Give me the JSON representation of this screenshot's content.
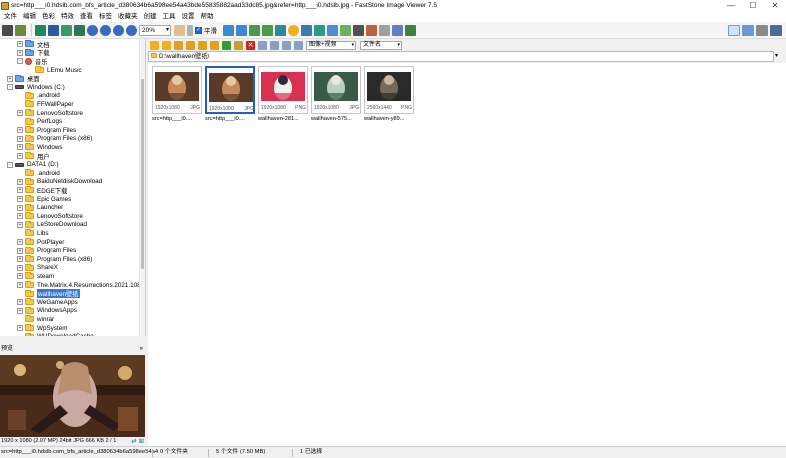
{
  "window": {
    "title": "src=http___i0.hdslb.com_bfs_article_d380634b6a598ee54a43bde55835882aad33dc85.jpg&refer=http___i0.hdslb.jpg - FastStone Image Viewer 7.5",
    "minimize": "—",
    "maximize": "☐",
    "close": "✕"
  },
  "menu": [
    "文件",
    "编辑",
    "色彩",
    "特效",
    "查看",
    "标签",
    "收藏夹",
    "创建",
    "工具",
    "设置",
    "帮助"
  ],
  "toolbar": {
    "zoom": "20%",
    "fit_label": "平滑",
    "fit_checked": "✓"
  },
  "browser_toolbar": {
    "view_mode": "图像+视频",
    "sort_by": "文件名"
  },
  "path": "D:\\wallhaven壁纸\\",
  "tree": [
    {
      "label": "文档",
      "level": 1,
      "exp": "+",
      "icon": "blue"
    },
    {
      "label": "下载",
      "level": 1,
      "exp": "+",
      "icon": "blue"
    },
    {
      "label": "音乐",
      "level": 1,
      "exp": "-",
      "icon": "red"
    },
    {
      "label": "LEmu Music",
      "level": 2,
      "exp": "",
      "icon": "yellow"
    },
    {
      "label": "桌面",
      "level": 0,
      "exp": "+",
      "icon": "blue"
    },
    {
      "label": "Windows (C:)",
      "level": 0,
      "exp": "-",
      "icon": "drive"
    },
    {
      "label": ".android",
      "level": 1,
      "exp": "",
      "icon": "yellow"
    },
    {
      "label": "FFWallPaper",
      "level": 1,
      "exp": "",
      "icon": "yellow"
    },
    {
      "label": "LenovoSoftstore",
      "level": 1,
      "exp": "+",
      "icon": "yellow"
    },
    {
      "label": "PerfLogs",
      "level": 1,
      "exp": "",
      "icon": "yellow"
    },
    {
      "label": "Program Files",
      "level": 1,
      "exp": "+",
      "icon": "yellow"
    },
    {
      "label": "Program Files (x86)",
      "level": 1,
      "exp": "+",
      "icon": "yellow"
    },
    {
      "label": "Windows",
      "level": 1,
      "exp": "+",
      "icon": "yellow"
    },
    {
      "label": "用户",
      "level": 1,
      "exp": "+",
      "icon": "yellow"
    },
    {
      "label": "DATA1 (D:)",
      "level": 0,
      "exp": "-",
      "icon": "drive"
    },
    {
      "label": ".android",
      "level": 1,
      "exp": "",
      "icon": "yellow"
    },
    {
      "label": "BaiduNetdiskDownload",
      "level": 1,
      "exp": "+",
      "icon": "yellow"
    },
    {
      "label": "EDGE下载",
      "level": 1,
      "exp": "+",
      "icon": "yellow"
    },
    {
      "label": "Epic Games",
      "level": 1,
      "exp": "+",
      "icon": "yellow"
    },
    {
      "label": "Launcher",
      "level": 1,
      "exp": "+",
      "icon": "yellow"
    },
    {
      "label": "LenovoSoftstore",
      "level": 1,
      "exp": "+",
      "icon": "yellow"
    },
    {
      "label": "LeStoreDownload",
      "level": 1,
      "exp": "+",
      "icon": "yellow"
    },
    {
      "label": "Libs",
      "level": 1,
      "exp": "",
      "icon": "yellow"
    },
    {
      "label": "PotPlayer",
      "level": 1,
      "exp": "+",
      "icon": "yellow"
    },
    {
      "label": "Program Files",
      "level": 1,
      "exp": "+",
      "icon": "yellow"
    },
    {
      "label": "Program Files (x86)",
      "level": 1,
      "exp": "+",
      "icon": "yellow"
    },
    {
      "label": "ShareX",
      "level": 1,
      "exp": "+",
      "icon": "yellow"
    },
    {
      "label": "steam",
      "level": 1,
      "exp": "+",
      "icon": "yellow"
    },
    {
      "label": "The.Matrix.4.Resurrections.2021.108",
      "level": 1,
      "exp": "+",
      "icon": "yellow"
    },
    {
      "label": "wallhaven壁纸",
      "level": 1,
      "exp": "",
      "icon": "yellow",
      "selected": true
    },
    {
      "label": "WeGameApps",
      "level": 1,
      "exp": "+",
      "icon": "yellow"
    },
    {
      "label": "WindowsApps",
      "level": 1,
      "exp": "+",
      "icon": "yellow"
    },
    {
      "label": "winrar",
      "level": 1,
      "exp": "",
      "icon": "yellow"
    },
    {
      "label": "WpSystem",
      "level": 1,
      "exp": "+",
      "icon": "yellow"
    },
    {
      "label": "WUDownloadCache",
      "level": 1,
      "exp": "",
      "icon": "yellow"
    }
  ],
  "thumbnails": [
    {
      "name": "src=http___i0....",
      "dims": "1920x1080",
      "type": "JPG",
      "selected": false,
      "palette": [
        "#5a3a28",
        "#c88a5a",
        "#e8c8a0"
      ]
    },
    {
      "name": "src=http___i0....",
      "dims": "1920x1080",
      "type": "JPG",
      "selected": true,
      "palette": [
        "#5a3a28",
        "#c88a5a",
        "#e8c8a0"
      ]
    },
    {
      "name": "wallhaven-281...",
      "dims": "1920x1080",
      "type": "PNG",
      "selected": false,
      "palette": [
        "#d83050",
        "#f0f0f0",
        "#2a2a3a"
      ]
    },
    {
      "name": "wallhaven-575...",
      "dims": "1920x1080",
      "type": "JPG",
      "selected": false,
      "palette": [
        "#3a5a48",
        "#b8d0c0",
        "#e8e8e0"
      ]
    },
    {
      "name": "wallhaven-y89...",
      "dims": "2560x1440",
      "type": "PNG",
      "selected": false,
      "palette": [
        "#2a2a28",
        "#786858",
        "#c8b8a0"
      ]
    }
  ],
  "preview": {
    "header": "预览",
    "pin": "»",
    "info": "1920 x 1080 (2.07 MP)  24bit  JPG   666 KB   2 / 1",
    "nav": "⇄ ⊠"
  },
  "status": {
    "filename": "src=http___i0.hdslb.com_bfs_article_d380634b6a598ee54a4",
    "folders": "0 个文件夹",
    "files": "5 个文件 (7.50 MB)",
    "selected": "1 已选择"
  }
}
